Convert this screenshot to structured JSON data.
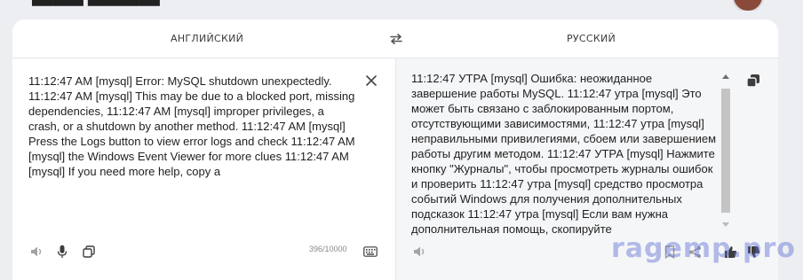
{
  "source_lang": "АНГЛИЙСКИЙ",
  "target_lang": "РУССКИЙ",
  "source_text": "11:12:47 AM [mysql] Error: MySQL shutdown unexpectedly. 11:12:47 AM [mysql] This may be due to a blocked port, missing dependencies, 11:12:47 AM [mysql] improper privileges, a crash, or a shutdown by another method. 11:12:47 AM [mysql] Press the Logs button to view error logs and check 11:12:47 AM [mysql] the Windows Event Viewer for more clues 11:12:47 AM [mysql] If you need more help, copy a",
  "target_text": "11:12:47 УТРА [mysql] Ошибка: неожиданное завершение работы MySQL. 11:12:47 утра [mysql] Это может быть связано с заблокированным портом, отсутствующими зависимостями, 11:12:47 утра [mysql] неправильными привилегиями, сбоем или завершением работы другим методом. 11:12:47 УТРА [mysql] Нажмите кнопку \"Журналы\", чтобы просмотреть журналы ошибок и проверить 11:12:47 утра [mysql] средство просмотра событий Windows для получения дополнительных подсказок 11:12:47 утра [mysql] Если вам нужна дополнительная помощь, скопируйте",
  "char_counter": "396/10000",
  "watermark": "ragemp.pro",
  "icons": {
    "swap": "swap-languages-icon",
    "clear": "close-icon",
    "copy": "copy-icon",
    "speaker": "speaker-icon",
    "mic": "microphone-icon",
    "keyboard": "keyboard-icon",
    "bookmark": "bookmark-icon",
    "share": "share-icon",
    "like": "thumbs-up-icon",
    "dislike": "thumbs-down-icon"
  },
  "colors": {
    "page_bg": "#eceef2",
    "card_bg": "#ffffff",
    "target_bg": "#f5f6f8",
    "watermark": "#5f6ed2"
  }
}
